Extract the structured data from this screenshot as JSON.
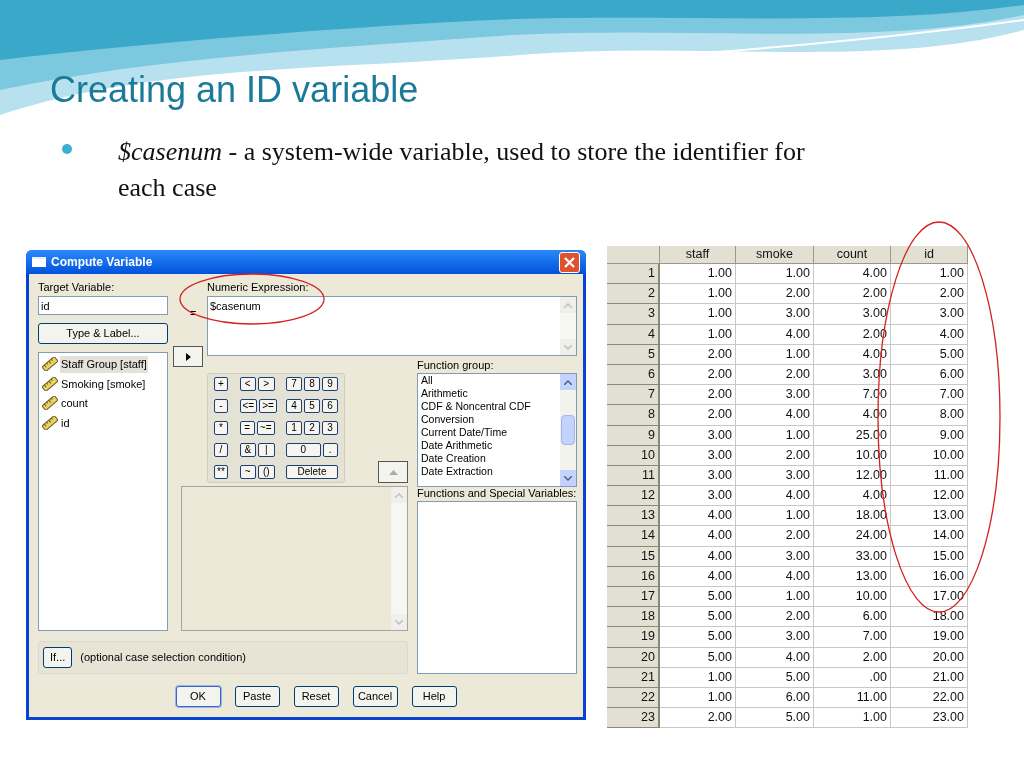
{
  "slide": {
    "title": "Creating an ID variable",
    "bullets": [
      "*$casenum* - a system-wide variable, used to store the identifier for each case"
    ]
  },
  "dialog": {
    "title": "Compute Variable",
    "target_label": "Target Variable:",
    "target_value": "id",
    "equals": "=",
    "type_label_button": "Type & Label...",
    "variables": [
      {
        "label": "Staff Group [staff]",
        "selected": true
      },
      {
        "label": "Smoking [smoke]",
        "selected": false
      },
      {
        "label": "count",
        "selected": false
      },
      {
        "label": "id",
        "selected": false
      }
    ],
    "expression_label": "Numeric Expression:",
    "expression_value": "$casenum",
    "keypad": [
      [
        [
          "+"
        ],
        [
          "<",
          ">"
        ],
        [
          "7",
          "8",
          "9"
        ]
      ],
      [
        [
          "-"
        ],
        [
          "<=",
          ">="
        ],
        [
          "4",
          "5",
          "6"
        ]
      ],
      [
        [
          "*"
        ],
        [
          "=",
          "~="
        ],
        [
          "1",
          "2",
          "3"
        ]
      ],
      [
        [
          "/"
        ],
        [
          "&",
          "|"
        ],
        [
          "0",
          "."
        ]
      ],
      [
        [
          "**"
        ],
        [
          "~",
          "()"
        ],
        [
          "Delete"
        ]
      ]
    ],
    "function_group_label": "Function group:",
    "function_groups": [
      "All",
      "Arithmetic",
      "CDF & Noncentral CDF",
      "Conversion",
      "Current Date/Time",
      "Date Arithmetic",
      "Date Creation",
      "Date Extraction"
    ],
    "functions_label": "Functions and Special Variables:",
    "if_button": "If...",
    "if_condition": "(optional case selection condition)",
    "buttons": [
      {
        "label": "OK",
        "default": true
      },
      {
        "label": "Paste",
        "default": false
      },
      {
        "label": "Reset",
        "default": false
      },
      {
        "label": "Cancel",
        "default": false
      },
      {
        "label": "Help",
        "default": false
      }
    ]
  },
  "data_view": {
    "columns": [
      "staff",
      "smoke",
      "count",
      "id"
    ],
    "rows": [
      {
        "n": "1",
        "cells": [
          "1.00",
          "1.00",
          "4.00",
          "1.00"
        ]
      },
      {
        "n": "2",
        "cells": [
          "1.00",
          "2.00",
          "2.00",
          "2.00"
        ]
      },
      {
        "n": "3",
        "cells": [
          "1.00",
          "3.00",
          "3.00",
          "3.00"
        ]
      },
      {
        "n": "4",
        "cells": [
          "1.00",
          "4.00",
          "2.00",
          "4.00"
        ]
      },
      {
        "n": "5",
        "cells": [
          "2.00",
          "1.00",
          "4.00",
          "5.00"
        ]
      },
      {
        "n": "6",
        "cells": [
          "2.00",
          "2.00",
          "3.00",
          "6.00"
        ]
      },
      {
        "n": "7",
        "cells": [
          "2.00",
          "3.00",
          "7.00",
          "7.00"
        ]
      },
      {
        "n": "8",
        "cells": [
          "2.00",
          "4.00",
          "4.00",
          "8.00"
        ]
      },
      {
        "n": "9",
        "cells": [
          "3.00",
          "1.00",
          "25.00",
          "9.00"
        ]
      },
      {
        "n": "10",
        "cells": [
          "3.00",
          "2.00",
          "10.00",
          "10.00"
        ]
      },
      {
        "n": "11",
        "cells": [
          "3.00",
          "3.00",
          "12.00",
          "11.00"
        ]
      },
      {
        "n": "12",
        "cells": [
          "3.00",
          "4.00",
          "4.00",
          "12.00"
        ]
      },
      {
        "n": "13",
        "cells": [
          "4.00",
          "1.00",
          "18.00",
          "13.00"
        ]
      },
      {
        "n": "14",
        "cells": [
          "4.00",
          "2.00",
          "24.00",
          "14.00"
        ]
      },
      {
        "n": "15",
        "cells": [
          "4.00",
          "3.00",
          "33.00",
          "15.00"
        ]
      },
      {
        "n": "16",
        "cells": [
          "4.00",
          "4.00",
          "13.00",
          "16.00"
        ]
      },
      {
        "n": "17",
        "cells": [
          "5.00",
          "1.00",
          "10.00",
          "17.00"
        ]
      },
      {
        "n": "18",
        "cells": [
          "5.00",
          "2.00",
          "6.00",
          "18.00"
        ]
      },
      {
        "n": "19",
        "cells": [
          "5.00",
          "3.00",
          "7.00",
          "19.00"
        ]
      },
      {
        "n": "20",
        "cells": [
          "5.00",
          "4.00",
          "2.00",
          "20.00"
        ]
      },
      {
        "n": "21",
        "cells": [
          "1.00",
          "5.00",
          ".00",
          "21.00"
        ]
      },
      {
        "n": "22",
        "cells": [
          "1.00",
          "6.00",
          "11.00",
          "22.00"
        ]
      },
      {
        "n": "23",
        "cells": [
          "2.00",
          "5.00",
          "1.00",
          "23.00"
        ]
      }
    ]
  }
}
